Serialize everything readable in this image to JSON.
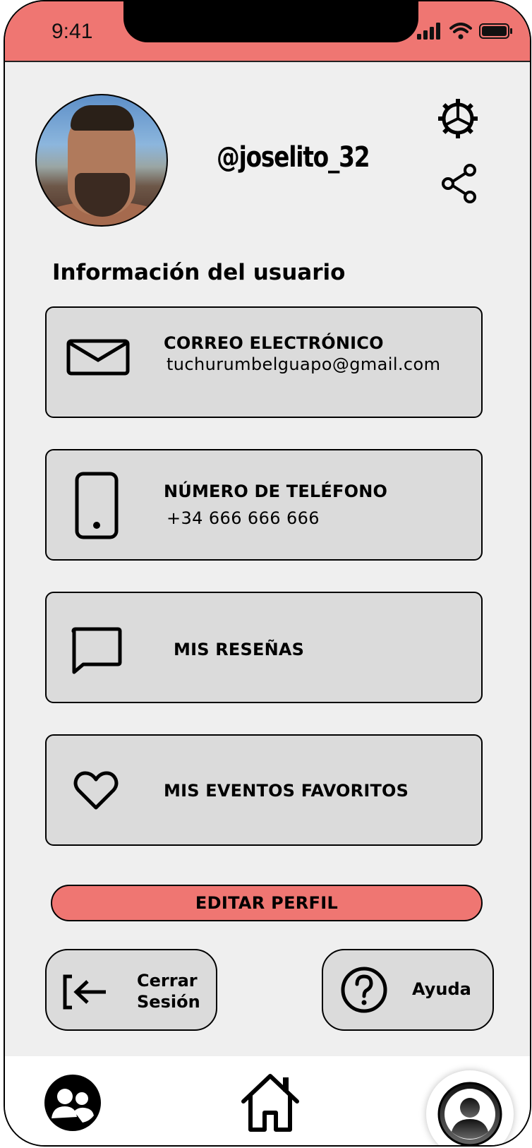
{
  "status_bar": {
    "time": "9:41"
  },
  "profile": {
    "username": "@joselito_32"
  },
  "section_title": "Información del usuario",
  "cards": {
    "email": {
      "title": "CORREO ELECTRÓNICO",
      "value": "tuchurumbelguapo@gmail.com",
      "icon": "mail-icon"
    },
    "phone": {
      "title": "NÚMERO DE TELÉFONO",
      "value": "+34 666 666 666",
      "icon": "smartphone-icon"
    },
    "reviews": {
      "title": "MIS RESEÑAS",
      "icon": "chat-bubble-icon"
    },
    "favorites": {
      "title": "MIS EVENTOS FAVORITOS",
      "icon": "heart-icon"
    }
  },
  "edit_button": "EDITAR PERFIL",
  "logout": {
    "line1": "Cerrar",
    "line2": "Sesión",
    "icon": "logout-icon"
  },
  "help": {
    "label": "Ayuda",
    "icon": "help-icon"
  },
  "bottom_nav": {
    "items": [
      "community-icon",
      "home-icon",
      "profile-icon"
    ],
    "active": "profile-icon"
  },
  "colors": {
    "accent": "#ef7672",
    "card": "#dbdbdb",
    "background": "#efefef"
  }
}
